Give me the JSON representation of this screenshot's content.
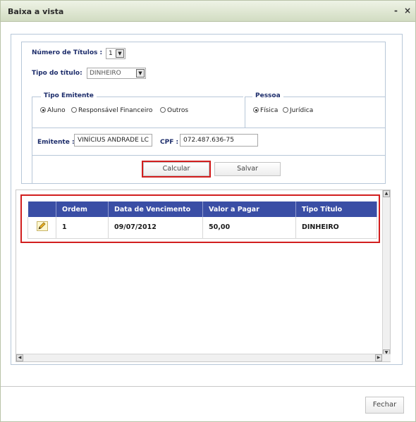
{
  "window": {
    "title": "Baixa a vista",
    "minimize_label": "-",
    "close_label": "×"
  },
  "form": {
    "num_titulos_label": "Número de Títulos :",
    "num_titulos_value": "1",
    "tipo_titulo_label": "Tipo do título:",
    "tipo_titulo_value": "DINHEIRO",
    "tipo_emitente": {
      "legend": "Tipo Emitente",
      "options": [
        {
          "label": "Aluno",
          "checked": true
        },
        {
          "label": "Responsável Financeiro",
          "checked": false
        },
        {
          "label": "Outros",
          "checked": false
        }
      ]
    },
    "pessoa": {
      "legend": "Pessoa",
      "options": [
        {
          "label": "Física",
          "checked": true
        },
        {
          "label": "Jurídica",
          "checked": false
        }
      ]
    },
    "emitente_label": "Emitente :",
    "emitente_value": "VINÍCIUS ANDRADE LC",
    "cpf_label": "CPF :",
    "cpf_value": "072.487.636-75",
    "calcular_label": "Calcular",
    "salvar_label": "Salvar"
  },
  "table": {
    "columns": [
      "",
      "Ordem",
      "Data de Vencimento",
      "Valor a Pagar",
      "Tipo Título"
    ],
    "rows": [
      {
        "icon": "pencil-icon",
        "ordem": "1",
        "data": "09/07/2012",
        "valor": "50,00",
        "tipo": "DINHEIRO"
      }
    ]
  },
  "footer": {
    "fechar_label": "Fechar"
  },
  "colors": {
    "header_blue": "#3a4ea5",
    "highlight_red": "#d21e1e",
    "titlebar_green": "#d2dcc2",
    "label_navy": "#1d2d6b"
  }
}
